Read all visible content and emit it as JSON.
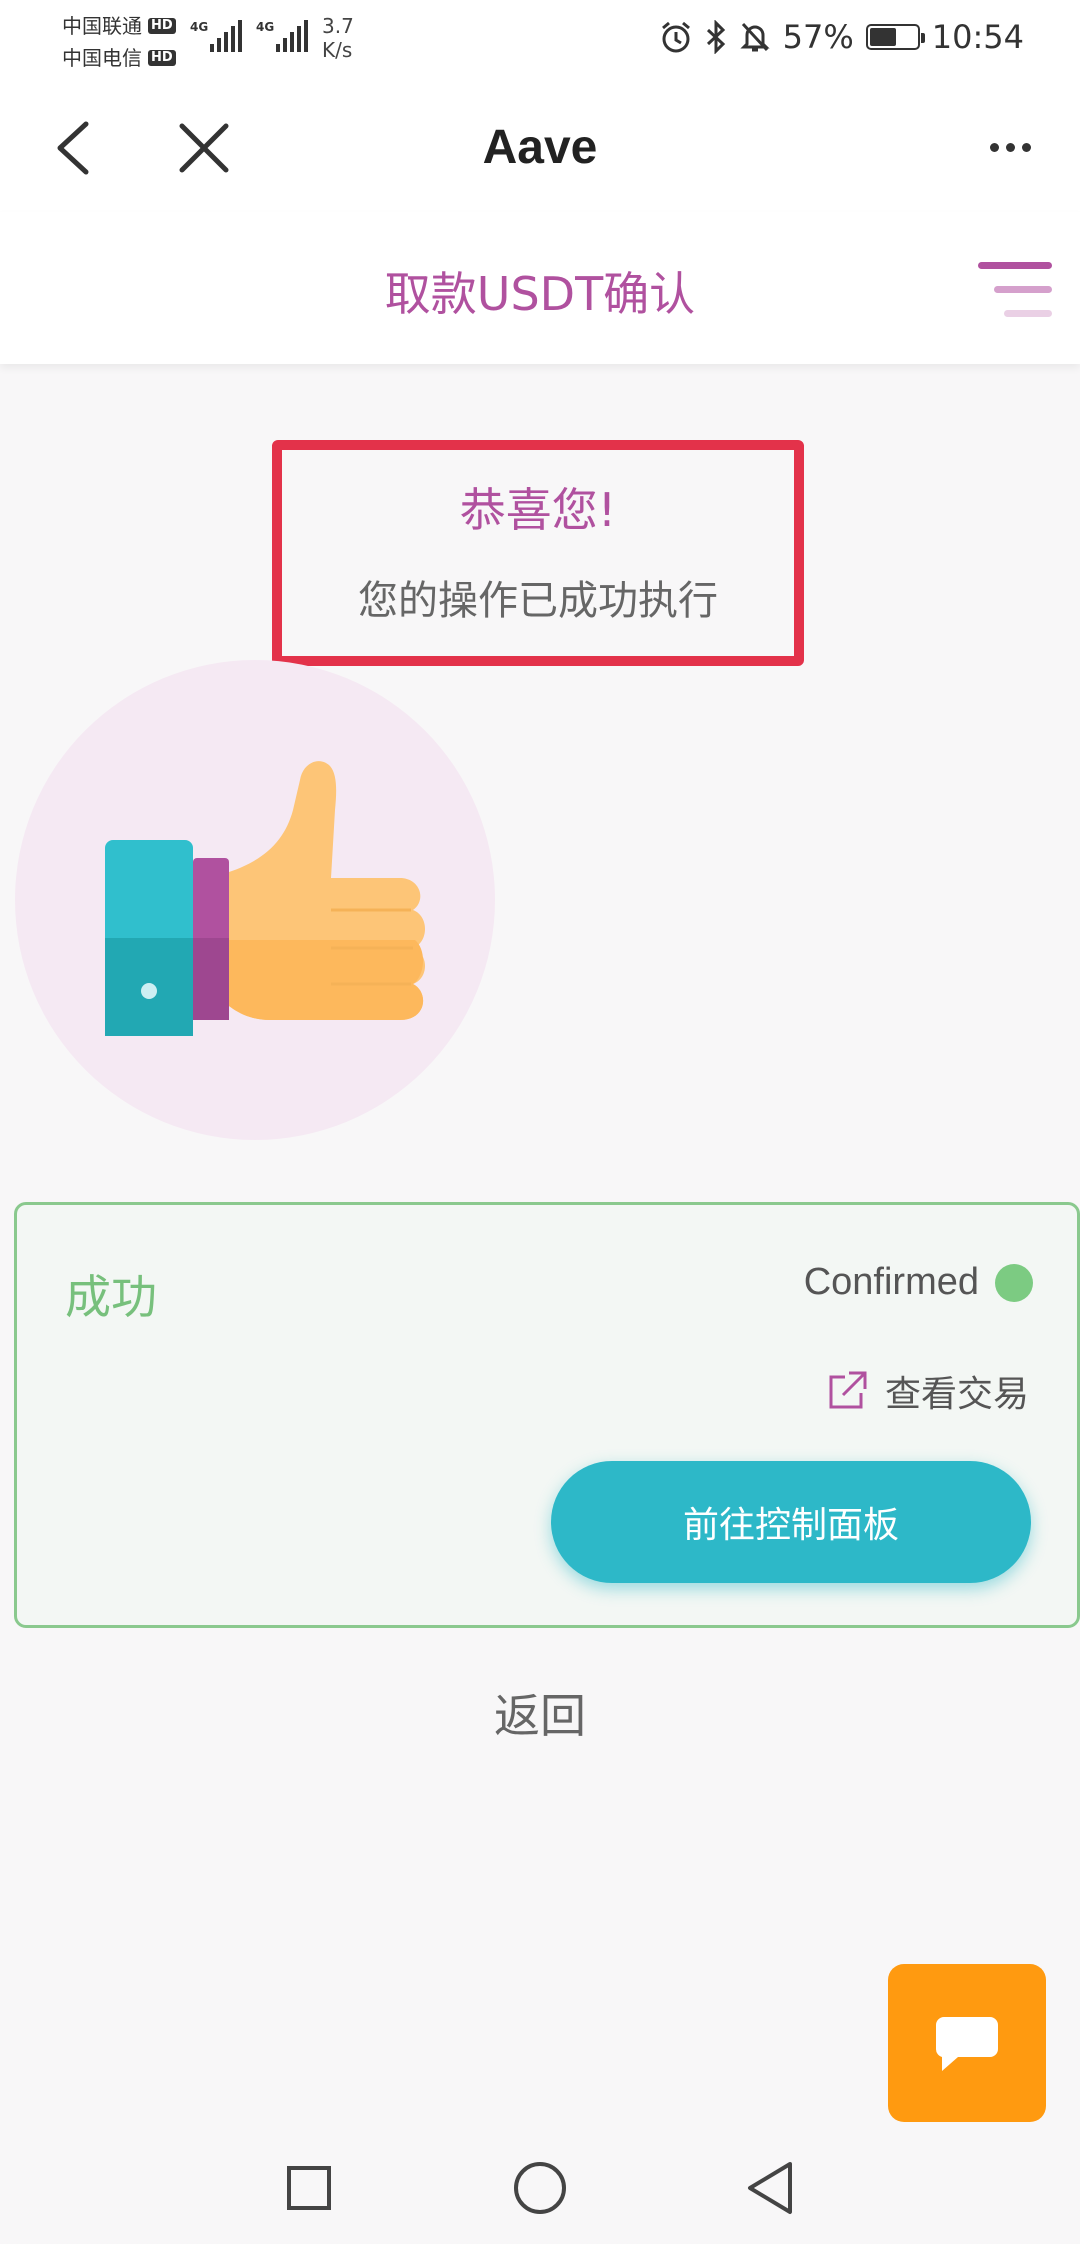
{
  "status_bar": {
    "carrier_1": "中国联通",
    "carrier_2": "中国电信",
    "hd_badge": "HD",
    "network_type": "4G",
    "speed_value": "3.7",
    "speed_unit": "K/s",
    "battery_percent": "57%",
    "battery_level": 0.57,
    "time": "10:54"
  },
  "nav_bar": {
    "title": "Aave"
  },
  "page": {
    "title": "取款USDT确认"
  },
  "congrats": {
    "title": "恭喜您!",
    "subtitle": "您的操作已成功执行"
  },
  "card": {
    "status_label": "成功",
    "confirmed_label": "Confirmed",
    "view_tx_label": "查看交易",
    "dashboard_button": "前往控制面板",
    "accent_color": "#2db8c8",
    "success_color": "#77c07c"
  },
  "back_link": "返回",
  "colors": {
    "brand": "#b0519f",
    "highlight_border": "#e3324a",
    "chat_button": "#ff9a10"
  }
}
